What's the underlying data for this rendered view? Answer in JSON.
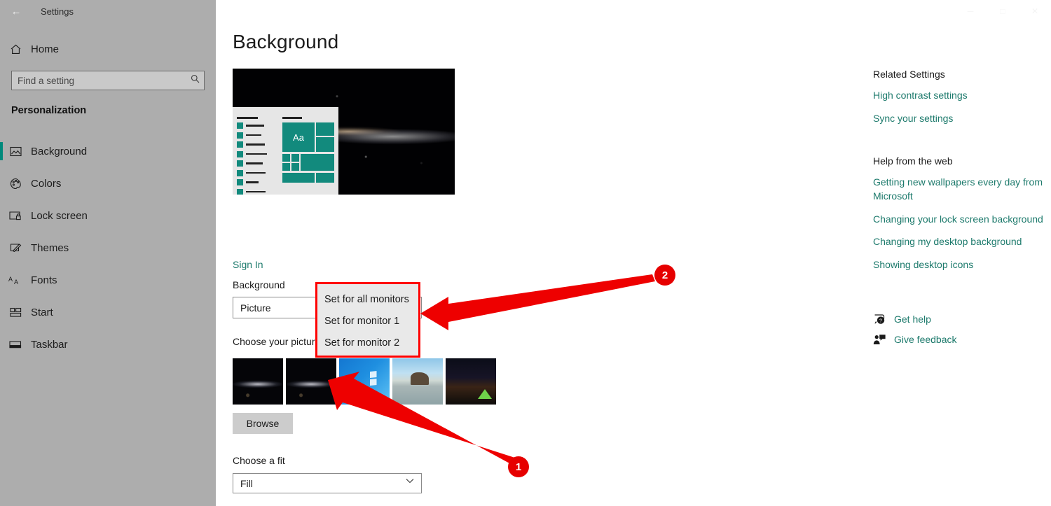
{
  "window": {
    "title": "Settings",
    "back_icon": "back-arrow-icon",
    "controls": [
      {
        "name": "minimize",
        "glyph": "─"
      },
      {
        "name": "maximize",
        "glyph": "□"
      },
      {
        "name": "close",
        "glyph": "✕"
      }
    ]
  },
  "sidebar": {
    "home_label": "Home",
    "home_icon": "home-icon",
    "search": {
      "placeholder": "Find a setting",
      "value": "",
      "icon": "search-icon"
    },
    "section_title": "Personalization",
    "accent_color": "#00897b",
    "items": [
      {
        "label": "Background",
        "icon": "image-icon",
        "selected": true
      },
      {
        "label": "Colors",
        "icon": "palette-icon",
        "selected": false
      },
      {
        "label": "Lock screen",
        "icon": "lock-screen-icon",
        "selected": false
      },
      {
        "label": "Themes",
        "icon": "themes-brush-icon",
        "selected": false
      },
      {
        "label": "Fonts",
        "icon": "fonts-aa-icon",
        "selected": false
      },
      {
        "label": "Start",
        "icon": "start-tiles-icon",
        "selected": false
      },
      {
        "label": "Taskbar",
        "icon": "taskbar-icon",
        "selected": false
      }
    ]
  },
  "main": {
    "page_title": "Background",
    "preview_alt": "desktop-preview-milky-way",
    "preview_tile_text": "Aa",
    "sign_in_link": "Sign In",
    "background_label": "Background",
    "background_value": "Picture",
    "choose_picture_label": "Choose your picture",
    "browse_button": "Browse",
    "fit_label": "Choose a fit",
    "fit_value": "Fill",
    "fit_chevron": "∨",
    "thumbnails": [
      {
        "name": "thumb-milky-way-1",
        "kind": "milky",
        "selected": false
      },
      {
        "name": "thumb-milky-way-2",
        "kind": "milky",
        "selected": true
      },
      {
        "name": "thumb-windows-default",
        "kind": "win",
        "selected": false
      },
      {
        "name": "thumb-beach-rock",
        "kind": "beach",
        "selected": false
      },
      {
        "name": "thumb-night-camp",
        "kind": "camp",
        "selected": false
      }
    ]
  },
  "context_menu": {
    "items": [
      "Set for all monitors",
      "Set for monitor 1",
      "Set for monitor 2"
    ],
    "highlight_color": "#ff0000"
  },
  "right_panel": {
    "related_heading": "Related Settings",
    "related_links": [
      "High contrast settings",
      "Sync your settings"
    ],
    "help_heading": "Help from the web",
    "help_links": [
      "Getting new wallpapers every day from Microsoft",
      "Changing your lock screen background",
      "Changing my desktop background",
      "Showing desktop icons"
    ],
    "bottom_links": [
      {
        "label": "Get help",
        "icon": "question-bubble-icon"
      },
      {
        "label": "Give feedback",
        "icon": "feedback-person-icon"
      }
    ],
    "link_color": "#1d7a6c"
  },
  "annotations": {
    "badges": [
      {
        "label": "1",
        "target": "thumb-milky-way-2"
      },
      {
        "label": "2",
        "target": "context-menu"
      }
    ],
    "color": "#e60000"
  }
}
